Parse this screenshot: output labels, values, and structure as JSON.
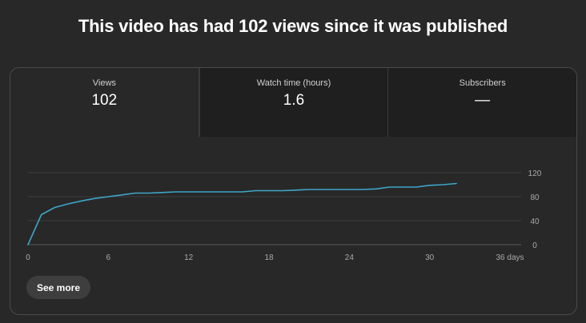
{
  "headline": "This video has had 102 views since it was published",
  "tabs": [
    {
      "label": "Views",
      "value": "102",
      "active": true
    },
    {
      "label": "Watch time (hours)",
      "value": "1.6",
      "active": false
    },
    {
      "label": "Subscribers",
      "value": "—",
      "active": false
    }
  ],
  "see_more_label": "See more",
  "colors": {
    "background": "#282828",
    "line": "#3ea6c8",
    "grid": "#3c3c3c",
    "tick_text": "#aaaaaa"
  },
  "chart_data": {
    "type": "line",
    "xlabel": "",
    "ylabel": "",
    "xlim": [
      0,
      36
    ],
    "ylim": [
      0,
      120
    ],
    "x_ticks": [
      {
        "value": 0,
        "label": "0"
      },
      {
        "value": 6,
        "label": "6"
      },
      {
        "value": 12,
        "label": "12"
      },
      {
        "value": 18,
        "label": "18"
      },
      {
        "value": 24,
        "label": "24"
      },
      {
        "value": 30,
        "label": "30"
      },
      {
        "value": 36,
        "label": "36 days"
      }
    ],
    "y_ticks": [
      {
        "value": 0,
        "label": "0"
      },
      {
        "value": 40,
        "label": "40"
      },
      {
        "value": 80,
        "label": "80"
      },
      {
        "value": 120,
        "label": "120"
      }
    ],
    "y_axis_position": "right",
    "grid": true,
    "legend": "none",
    "series": [
      {
        "x": [
          0,
          1,
          2,
          3,
          4,
          5,
          6,
          7,
          8,
          9,
          10,
          11,
          12,
          13,
          14,
          15,
          16,
          17,
          18,
          19,
          20,
          21,
          22,
          23,
          24,
          25,
          26,
          27,
          28,
          29,
          30,
          31,
          32
        ],
        "values": [
          0,
          50,
          62,
          68,
          73,
          77,
          80,
          83,
          86,
          86,
          87,
          88,
          88,
          88,
          88,
          88,
          88,
          90,
          90,
          90,
          91,
          92,
          92,
          92,
          92,
          92,
          93,
          96,
          96,
          96,
          99,
          100,
          102
        ]
      }
    ]
  }
}
